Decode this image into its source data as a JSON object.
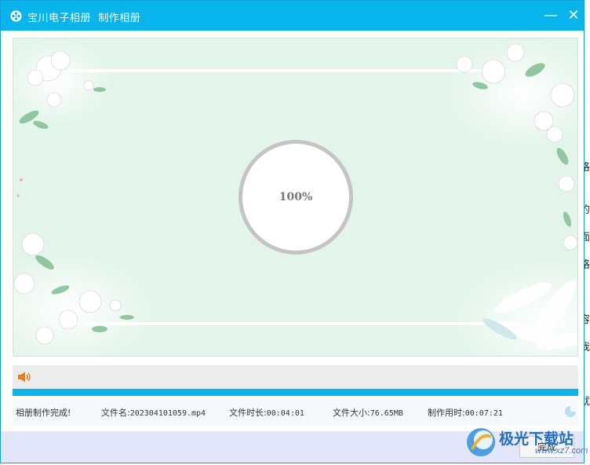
{
  "window": {
    "app_name": "宝川电子相册",
    "title": "制作相册"
  },
  "window_controls": {
    "minimize": "—",
    "close": "✕"
  },
  "preview": {
    "progress_text": "100%"
  },
  "progress": {
    "fraction": 1.0
  },
  "status": {
    "message": "相册制作完成!",
    "file_name_label": "文件名:",
    "file_name": "202304101059.mp4",
    "duration_label": "文件时长:",
    "duration": "00:04:01",
    "size_label": "文件大小:",
    "size": "76.65MB",
    "time_label": "制作用时:",
    "time": "00:07:21"
  },
  "footer": {
    "done_label": "完成"
  },
  "background_chars": [
    "格",
    "的",
    "面",
    "格",
    "容",
    "我",
    "就"
  ],
  "watermark": {
    "text": "极光下载站",
    "sub": "www.xz7.com"
  },
  "colors": {
    "accent": "#08b4ec",
    "stage": "#e3f5ea",
    "footer": "#e4e6fb",
    "speaker": "#f07a13"
  },
  "icons": {
    "app": "film-reel-icon",
    "speaker": "speaker-icon",
    "loader": "loading-icon"
  }
}
